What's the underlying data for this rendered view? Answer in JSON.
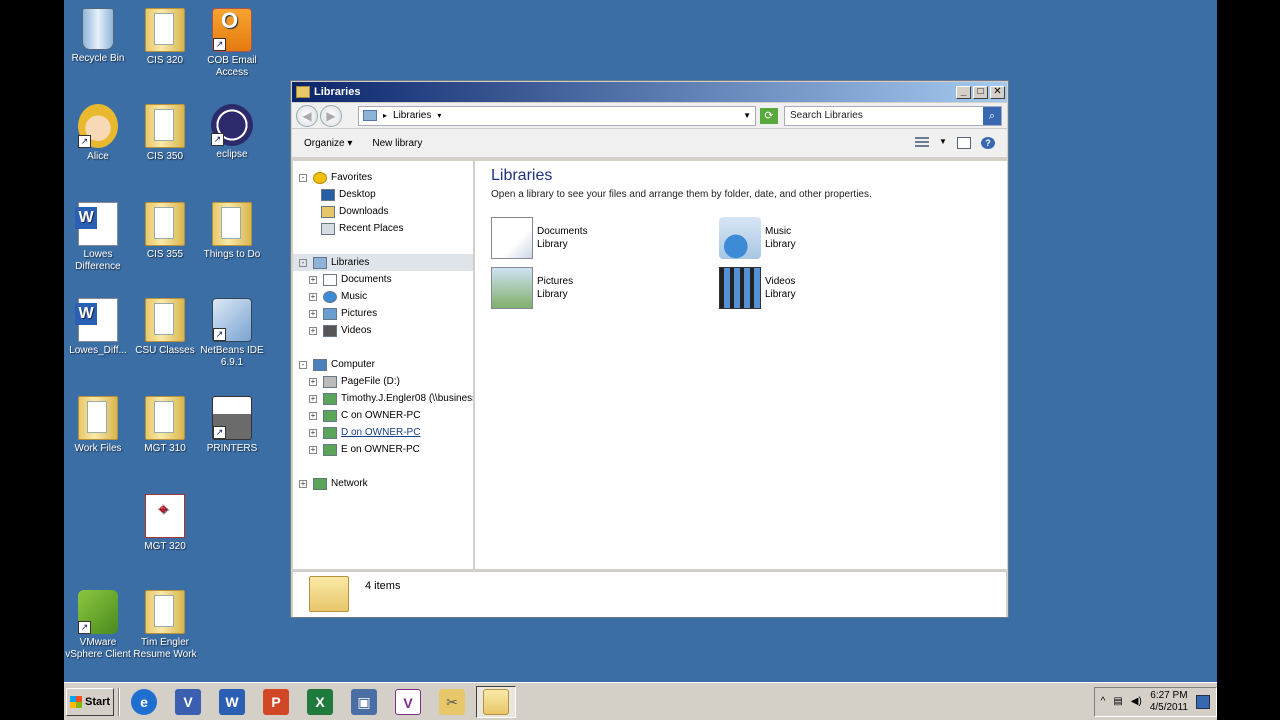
{
  "desktop": {
    "icons": [
      {
        "label": "Recycle Bin"
      },
      {
        "label": "CIS 320"
      },
      {
        "label": "COB Email Access"
      },
      {
        "label": "Alice"
      },
      {
        "label": "CIS 350"
      },
      {
        "label": "eclipse"
      },
      {
        "label": "Lowes Difference"
      },
      {
        "label": "CIS 355"
      },
      {
        "label": "Things to Do"
      },
      {
        "label": "Lowes_Diff..."
      },
      {
        "label": "CSU Classes"
      },
      {
        "label": "NetBeans IDE 6.9.1"
      },
      {
        "label": "Work Files"
      },
      {
        "label": "MGT 310"
      },
      {
        "label": "PRINTERS"
      },
      {
        "label": "MGT 320"
      },
      {
        "label": "VMware vSphere Client"
      },
      {
        "label": "Tim Engler Resume Work"
      }
    ]
  },
  "window": {
    "title": "Libraries",
    "buttons": {
      "minimize": "_",
      "maximize": "□",
      "close": "✕"
    },
    "address": {
      "path": "Libraries",
      "separator": "▸"
    },
    "search": {
      "placeholder": "Search Libraries"
    },
    "toolbar": {
      "organize": "Organize ▾",
      "new_library": "New library"
    },
    "nav": {
      "favorites": {
        "label": "Favorites",
        "items": [
          "Desktop",
          "Downloads",
          "Recent Places"
        ]
      },
      "libraries": {
        "label": "Libraries",
        "items": [
          "Documents",
          "Music",
          "Pictures",
          "Videos"
        ]
      },
      "computer": {
        "label": "Computer",
        "items": [
          "PageFile (D:)",
          "Timothy.J.Engler08 (\\\\business",
          "C on OWNER-PC",
          "D on OWNER-PC",
          "E on OWNER-PC"
        ]
      },
      "network": {
        "label": "Network"
      }
    },
    "content": {
      "title": "Libraries",
      "subtitle": "Open a library to see your files and arrange them by folder, date, and other properties.",
      "libraries": [
        {
          "name": "Documents",
          "type": "Library"
        },
        {
          "name": "Music",
          "type": "Library"
        },
        {
          "name": "Pictures",
          "type": "Library"
        },
        {
          "name": "Videos",
          "type": "Library"
        }
      ]
    },
    "details": {
      "count": "4 items"
    }
  },
  "taskbar": {
    "start": "Start",
    "clock": {
      "time": "6:27 PM",
      "date": "4/5/2011"
    }
  }
}
